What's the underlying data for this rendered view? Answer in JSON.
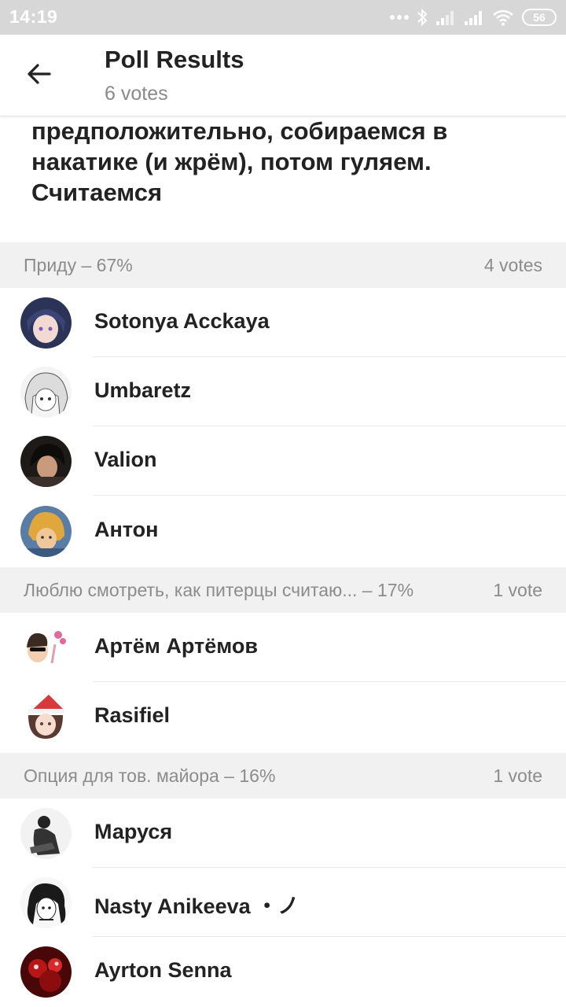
{
  "status_bar": {
    "time": "14:19",
    "battery": "56",
    "icons": [
      "more-dots-icon",
      "bluetooth-icon",
      "signal-icon",
      "signal-icon",
      "wifi-icon",
      "battery-icon"
    ]
  },
  "header": {
    "back_icon": "arrow-left-icon",
    "title": "Poll Results",
    "subtitle": "6 votes"
  },
  "question": {
    "text": "предположительно, собираемся в накатике (и жрём), потом гуляем. Считаемся"
  },
  "options": [
    {
      "title": "Приду – 67%",
      "votes": "4 votes",
      "voters": [
        {
          "name": "Sotonya Acckaya"
        },
        {
          "name": "Umbaretz"
        },
        {
          "name": "Valion"
        },
        {
          "name": "Антон"
        }
      ]
    },
    {
      "title": "Люблю смотреть, как питерцы считаю... – 17%",
      "votes": "1 vote",
      "voters": [
        {
          "name": "Артём Артёмов"
        },
        {
          "name": "Rasifiel"
        }
      ]
    },
    {
      "title": "Опция для тов. майора – 16%",
      "votes": "1 vote",
      "voters": [
        {
          "name": "Маруся"
        },
        {
          "name": "Nasty Anikeeva ・ノ"
        },
        {
          "name": "Ayrton Senna"
        }
      ]
    }
  ],
  "colors": {
    "status_bar": "#d7d7d7",
    "section_bg": "#f1f1f1",
    "muted_text": "#8c8c8c",
    "primary_text": "#222222"
  }
}
